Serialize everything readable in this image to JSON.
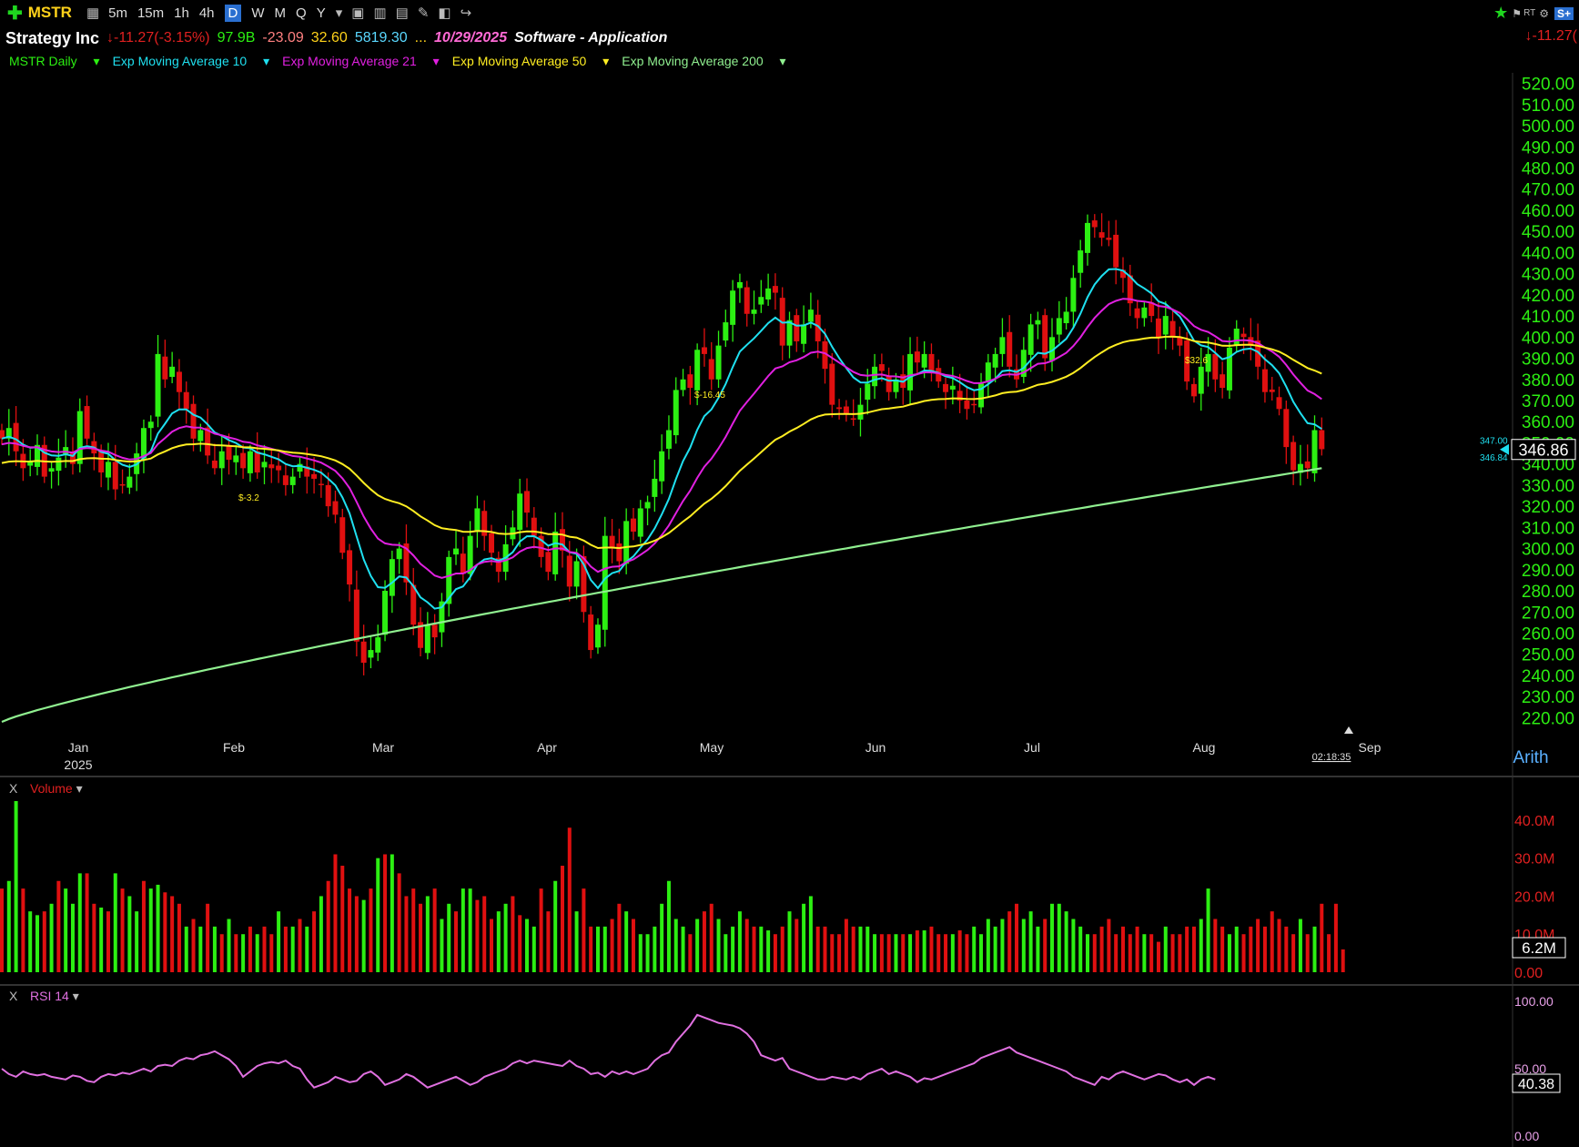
{
  "toolbar": {
    "ticker": "MSTR",
    "timeframes": [
      "5m",
      "15m",
      "1h",
      "4h",
      "D",
      "W",
      "M",
      "Q",
      "Y"
    ],
    "selected": "D",
    "realtime": "RT",
    "splus": "S+"
  },
  "info": {
    "company": "Strategy Inc",
    "change": "-11.27",
    "change_pct": "(-3.15%)",
    "mkt_cap": "97.9B",
    "eps": "-23.09",
    "pe": "32.60",
    "shares": "5819.30",
    "ellipsis": "...",
    "earnings_date": "10/29/2025",
    "industry": "Software - Application",
    "right_change": "-11.27("
  },
  "legend": {
    "main": "MSTR Daily",
    "ema10": "Exp Moving Average 10",
    "ema21": "Exp Moving Average 21",
    "ema50": "Exp Moving Average 50",
    "ema200": "Exp Moving Average 200"
  },
  "colors": {
    "up": "#2cef12",
    "down": "#e01010",
    "ema10": "#1fe0f0",
    "ema21": "#e020e0",
    "ema50": "#ffee22",
    "ema200": "#90f090",
    "rsi": "#e070e0",
    "axis": "#2cef12"
  },
  "chart_data": [
    {
      "type": "candlestick",
      "title": "MSTR Daily",
      "scale": "Arith",
      "ylim": [
        215,
        525
      ],
      "yticks": [
        "520.00",
        "510.00",
        "500.00",
        "490.00",
        "480.00",
        "470.00",
        "460.00",
        "450.00",
        "440.00",
        "430.00",
        "420.00",
        "410.00",
        "400.00",
        "390.00",
        "380.00",
        "370.00",
        "360.00",
        "350.00",
        "340.00",
        "330.00",
        "320.00",
        "310.00",
        "300.00",
        "290.00",
        "280.00",
        "270.00",
        "260.00",
        "250.00",
        "240.00",
        "230.00",
        "220.00"
      ],
      "x_month_labels": [
        "Jan",
        "Feb",
        "Mar",
        "Apr",
        "May",
        "Jun",
        "Jul",
        "Aug",
        "Sep"
      ],
      "x_year_label": "2025",
      "last_price": "346.86",
      "bid": "347.00",
      "ask": "346.84",
      "countdown": "02:18:35",
      "annotations": [
        "$-3.2",
        "$-16.45",
        "$32.6"
      ],
      "close": [
        352,
        357,
        346,
        338,
        341,
        349,
        334,
        338,
        343,
        348,
        340,
        365,
        352,
        345,
        336,
        341,
        328,
        330,
        334,
        345,
        357,
        360,
        392,
        380,
        386,
        374,
        366,
        352,
        356,
        344,
        338,
        346,
        342,
        344,
        338,
        346,
        336,
        341,
        338,
        337,
        330,
        334,
        340,
        334,
        333,
        330,
        320,
        316,
        298,
        283,
        256,
        246,
        252,
        258,
        280,
        295,
        300,
        284,
        264,
        253,
        264,
        258,
        275,
        296,
        300,
        288,
        306,
        319,
        306,
        298,
        289,
        302,
        310,
        326,
        317,
        306,
        296,
        289,
        308,
        299,
        282,
        294,
        270,
        252,
        264,
        306,
        300,
        294,
        313,
        308,
        319,
        322,
        333,
        346,
        356,
        375,
        380,
        376,
        394,
        392,
        380,
        396,
        407,
        422,
        426,
        411,
        413,
        419,
        423,
        421,
        396,
        408,
        398,
        406,
        413,
        398,
        385,
        368,
        366,
        364,
        361,
        368,
        378,
        386,
        384,
        374,
        380,
        376,
        392,
        388,
        392,
        383,
        379,
        374,
        377,
        370,
        366,
        368,
        378,
        388,
        392,
        400,
        386,
        380,
        394,
        406,
        408,
        390,
        400,
        409,
        412,
        428,
        441,
        454,
        452,
        447,
        446,
        433,
        428,
        416,
        409,
        414,
        410,
        400,
        410,
        400,
        396,
        379,
        372,
        386,
        392,
        380,
        376,
        395,
        404,
        400,
        396,
        386,
        374,
        374,
        366,
        348,
        337,
        340,
        338,
        356,
        347
      ],
      "ema10_final": 360,
      "ema21_final": 374,
      "ema50_final": 384,
      "ema200_end": 338
    },
    {
      "type": "bar",
      "title": "Volume",
      "ylim": [
        0,
        45
      ],
      "yticks": [
        "40.0M",
        "30.0M",
        "20.0M",
        "10.0M",
        "0.00"
      ],
      "last_value": "6.2M",
      "values": [
        22,
        24,
        45,
        22,
        16,
        15,
        16,
        18,
        24,
        22,
        18,
        26,
        26,
        18,
        17,
        16,
        26,
        22,
        20,
        16,
        24,
        22,
        23,
        21,
        20,
        18,
        12,
        14,
        12,
        18,
        12,
        10,
        14,
        10,
        10,
        12,
        10,
        12,
        10,
        16,
        12,
        12,
        14,
        12,
        16,
        20,
        24,
        31,
        28,
        22,
        20,
        19,
        22,
        30,
        31,
        31,
        26,
        20,
        22,
        18,
        20,
        22,
        14,
        18,
        16,
        22,
        22,
        19,
        20,
        14,
        16,
        18,
        20,
        15,
        14,
        12,
        22,
        16,
        24,
        28,
        38,
        16,
        22,
        12,
        12,
        12,
        14,
        18,
        16,
        14,
        10,
        10,
        12,
        18,
        24,
        14,
        12,
        10,
        14,
        16,
        18,
        14,
        10,
        12,
        16,
        14,
        12,
        12,
        11,
        10,
        12,
        16,
        14,
        18,
        20,
        12,
        12,
        10,
        10,
        14,
        12,
        12,
        12,
        10,
        10,
        10,
        10,
        10,
        10,
        11,
        11,
        12,
        10,
        10,
        10,
        11,
        10,
        12,
        10,
        14,
        12,
        14,
        16,
        18,
        14,
        16,
        12,
        14,
        18,
        18,
        16,
        14,
        12,
        10,
        10,
        12,
        14,
        10,
        12,
        10,
        12,
        10,
        10,
        8,
        12,
        10,
        10,
        12,
        12,
        14,
        22,
        14,
        12,
        10,
        12,
        10,
        12,
        14,
        12,
        16,
        14,
        12,
        10,
        14,
        10,
        12,
        18,
        10,
        18,
        6
      ],
      "up": [
        false,
        true,
        true,
        false,
        true,
        true,
        false,
        true,
        false,
        true,
        true,
        true,
        false,
        false,
        true,
        false,
        true,
        false,
        true,
        true,
        false,
        true,
        true,
        false,
        false,
        false,
        true,
        false,
        true,
        false,
        true,
        false,
        true,
        false,
        true,
        false,
        true,
        false,
        false,
        true,
        false,
        true,
        false,
        true,
        false,
        true,
        false,
        false,
        false,
        false,
        false,
        true,
        false,
        true,
        false,
        true,
        false,
        false,
        false,
        false,
        true,
        false,
        true,
        true,
        false,
        true,
        true,
        false,
        false,
        false,
        true,
        true,
        false,
        false,
        true,
        true,
        false,
        false,
        true,
        false,
        false,
        true,
        false,
        false,
        true,
        true,
        false,
        false,
        true,
        false,
        true,
        true,
        true,
        true,
        true,
        true,
        true,
        false,
        true,
        false,
        false,
        true,
        true,
        true,
        true,
        false,
        false,
        true,
        true,
        false,
        false,
        true,
        false,
        true,
        true,
        false,
        false,
        false,
        false,
        false,
        false,
        true,
        true,
        true,
        false,
        false,
        true,
        false,
        true,
        false,
        true,
        false,
        false,
        false,
        true,
        false,
        false,
        true,
        true,
        true,
        true,
        true,
        false,
        false,
        true,
        true,
        true,
        false,
        true,
        true,
        true,
        true,
        true,
        true,
        false,
        false,
        false,
        false,
        false,
        false,
        false,
        true,
        false,
        false,
        true,
        false,
        false,
        false,
        false,
        true,
        true,
        false,
        false,
        true,
        true,
        false,
        false,
        false,
        false,
        false,
        false,
        false,
        false,
        true,
        false,
        true,
        false
      ]
    },
    {
      "type": "line",
      "title": "RSI 14",
      "ylim": [
        0,
        100
      ],
      "yticks": [
        "100.00",
        "50.00",
        "0.00"
      ],
      "last_value": "40.38",
      "values": [
        50,
        46,
        44,
        48,
        46,
        45,
        46,
        44,
        43,
        42,
        45,
        44,
        41,
        40,
        44,
        46,
        45,
        47,
        46,
        48,
        50,
        48,
        52,
        53,
        52,
        56,
        58,
        57,
        60,
        61,
        63,
        60,
        57,
        52,
        44,
        48,
        52,
        54,
        55,
        54,
        56,
        52,
        50,
        42,
        36,
        38,
        40,
        44,
        42,
        40,
        41,
        46,
        48,
        44,
        38,
        40,
        42,
        46,
        44,
        40,
        36,
        38,
        40,
        42,
        44,
        41,
        38,
        40,
        44,
        46,
        48,
        50,
        54,
        56,
        54,
        56,
        55,
        54,
        53,
        52,
        56,
        52,
        50,
        46,
        47,
        44,
        48,
        46,
        48,
        46,
        48,
        50,
        56,
        60,
        62,
        70,
        76,
        82,
        90,
        88,
        86,
        84,
        83,
        82,
        80,
        76,
        70,
        60,
        58,
        56,
        58,
        50,
        48,
        46,
        44,
        42,
        42,
        44,
        43,
        42,
        44,
        42,
        46,
        48,
        50,
        46,
        48,
        46,
        44,
        40,
        43,
        42,
        44,
        46,
        48,
        50,
        52,
        54,
        58,
        60,
        62,
        64,
        66,
        62,
        60,
        58,
        56,
        54,
        52,
        50,
        48,
        44,
        42,
        40,
        38,
        44,
        42,
        46,
        48,
        46,
        44,
        42,
        44,
        46,
        45,
        42,
        40,
        42,
        38,
        42,
        44,
        42
      ]
    }
  ]
}
